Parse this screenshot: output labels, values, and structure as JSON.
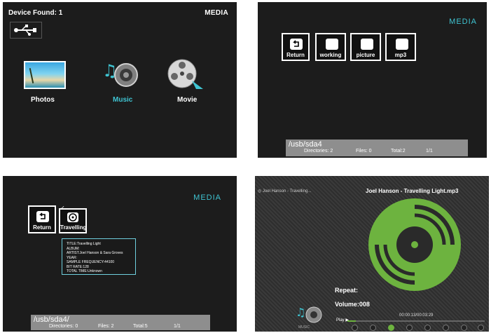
{
  "home": {
    "device_found_label": "Device Found:",
    "device_count": "1",
    "media_label": "MEDIA",
    "items": [
      {
        "label": "Photos"
      },
      {
        "label": "Music"
      },
      {
        "label": "Movie"
      }
    ]
  },
  "browser1": {
    "media_label": "MEDIA",
    "tiles": [
      {
        "label": "Return"
      },
      {
        "label": "working"
      },
      {
        "label": "picture"
      },
      {
        "label": "mp3"
      }
    ],
    "path": "/usb/sda4",
    "directories": "Directories: 2",
    "files": "Files: 0",
    "total": "Total:2",
    "page": "1/1"
  },
  "browser2": {
    "media_label": "MEDIA",
    "tiles": [
      {
        "label": "Return"
      },
      {
        "label": "Travelling"
      }
    ],
    "info_lines": [
      "TITLE:Travelling Light",
      "ALBUM:",
      "ARTIST:Joel Hanson & Sara Groves",
      "YEAR:",
      "SAMPLE FREQUENCY:44100",
      "BIT RATE:128",
      "TOTAL TIME:Unknown"
    ],
    "path": "/usb/sda4/",
    "directories": "Directories: 0",
    "files": "Files: 2",
    "total": "Total:5",
    "page": "1/1"
  },
  "player": {
    "header_track": "Joel Hanson - Travelling...",
    "title": "Joel Hanson - Travelling Light.mp3",
    "repeat_label": "Repeat:",
    "volume_label": "Volume:008",
    "time": "00:00:13/00:03:29",
    "play_label": "Play",
    "music_caption": "MUSIC",
    "progress": 0.06,
    "colors": {
      "accent": "#6db33f",
      "teal": "#3fc4d2"
    }
  }
}
